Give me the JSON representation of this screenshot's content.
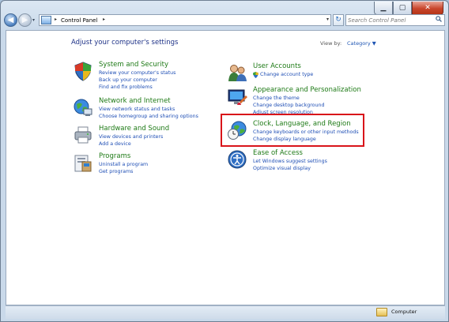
{
  "window": {
    "minimize_glyph": "▁",
    "maximize_glyph": "▢",
    "close_glyph": "✕"
  },
  "nav": {
    "back_glyph": "◀",
    "forward_glyph": "▶"
  },
  "address": {
    "separator": "▸",
    "crumb": "Control Panel",
    "dropdown_glyph": "▾"
  },
  "search": {
    "placeholder": "Search Control Panel"
  },
  "header": {
    "title": "Adjust your computer's settings",
    "view_by_label": "View by:",
    "view_by_value": "Category ▼"
  },
  "categories": [
    {
      "title": "System and Security",
      "icon": "shield-icon",
      "links": [
        "Review your computer's status",
        "Back up your computer",
        "Find and fix problems"
      ]
    },
    {
      "title": "Network and Internet",
      "icon": "network-globe-icon",
      "links": [
        "View network status and tasks",
        "Choose homegroup and sharing options"
      ]
    },
    {
      "title": "Hardware and Sound",
      "icon": "printer-icon",
      "links": [
        "View devices and printers",
        "Add a device"
      ]
    },
    {
      "title": "Programs",
      "icon": "programs-icon",
      "links": [
        "Uninstall a program",
        "Get programs"
      ]
    },
    {
      "title": "User Accounts",
      "icon": "users-icon",
      "links": [
        "Change account type"
      ]
    },
    {
      "title": "Appearance and Personalization",
      "icon": "monitor-brush-icon",
      "links": [
        "Change the theme",
        "Change desktop background",
        "Adjust screen resolution"
      ]
    },
    {
      "title": "Clock, Language, and Region",
      "icon": "clock-globe-icon",
      "links": [
        "Change keyboards or other input methods",
        "Change display language"
      ]
    },
    {
      "title": "Ease of Access",
      "icon": "ease-of-access-icon",
      "links": [
        "Let Windows suggest settings",
        "Optimize visual display"
      ]
    }
  ],
  "status": {
    "label": "Computer"
  },
  "colors": {
    "category_title": "#1e7a16",
    "link": "#1f4fb5",
    "page_title": "#1e3287",
    "highlight": "#d9141a"
  }
}
